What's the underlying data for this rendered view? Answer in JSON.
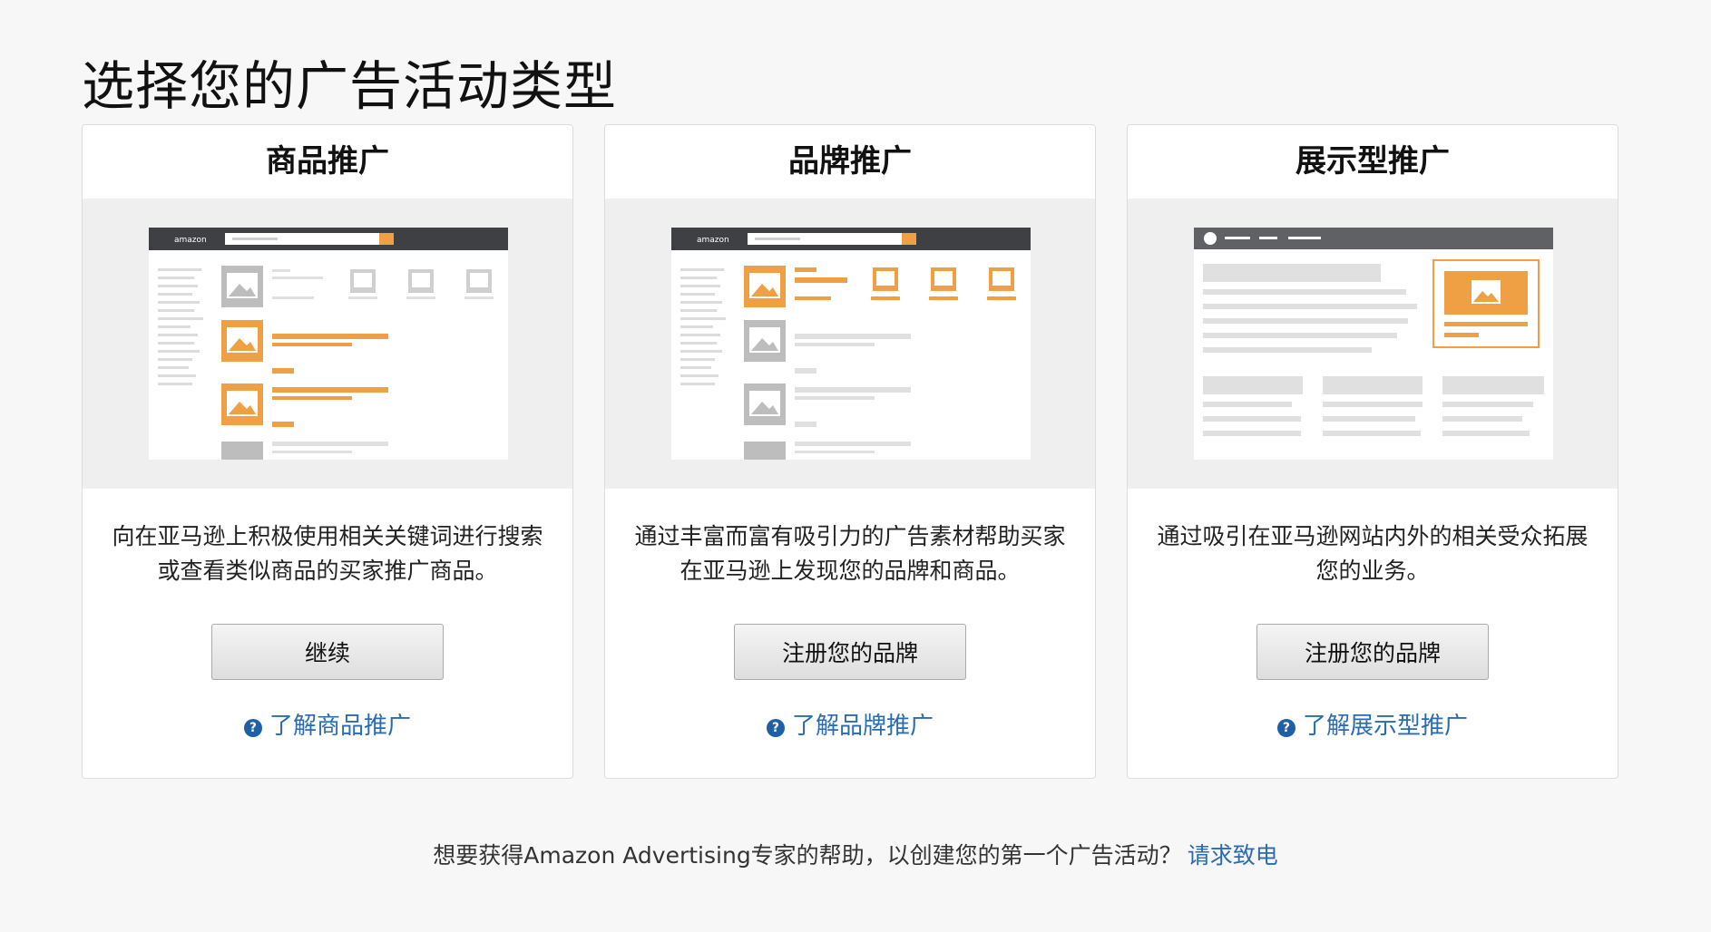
{
  "page": {
    "title": "选择您的广告活动类型"
  },
  "cards": [
    {
      "title": "商品推广",
      "description": "向在亚马逊上积极使用相关关键词进行搜索或查看类似商品的买家推广商品。",
      "button_label": "继续",
      "learn_more": "了解商品推广"
    },
    {
      "title": "品牌推广",
      "description": "通过丰富而富有吸引力的广告素材帮助买家在亚马逊上发现您的品牌和商品。",
      "button_label": "注册您的品牌",
      "learn_more": "了解品牌推广"
    },
    {
      "title": "展示型推广",
      "description": "通过吸引在亚马逊网站内外的相关受众拓展您的业务。",
      "button_label": "注册您的品牌",
      "learn_more": "了解展示型推广"
    }
  ],
  "footer": {
    "text": "想要获得Amazon Advertising专家的帮助，以创建您的第一个广告活动？",
    "link": "请求致电"
  },
  "illustration_logo": "amazon",
  "colors": {
    "accent_orange": "#f0a044",
    "link_blue": "#2b6cb0",
    "mock_header": "#3e4043"
  }
}
